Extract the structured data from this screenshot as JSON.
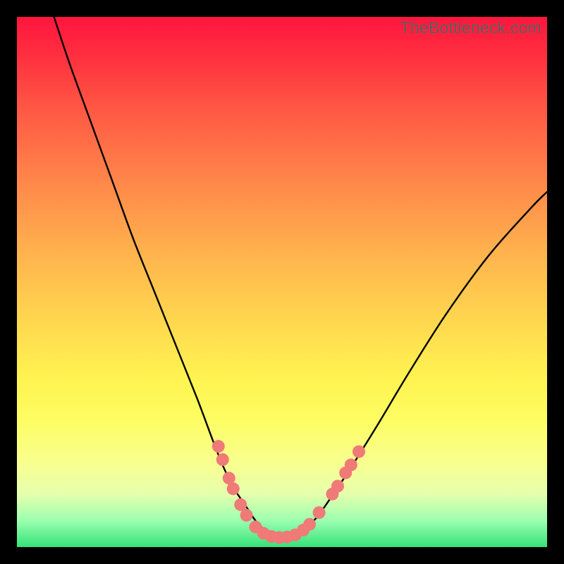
{
  "watermark": "TheBottleneck.com",
  "chart_data": {
    "type": "line",
    "title": "",
    "xlabel": "",
    "ylabel": "",
    "xlim": [
      0,
      100
    ],
    "ylim": [
      0,
      100
    ],
    "series": [
      {
        "name": "bottleneck-curve",
        "x": [
          7,
          10,
          14,
          18,
          22,
          26,
          30,
          34,
          37,
          39,
          41,
          43,
          45,
          47,
          49,
          51,
          53,
          56,
          59,
          63,
          68,
          74,
          81,
          89,
          97,
          100
        ],
        "y": [
          100,
          91,
          80,
          69,
          58,
          48,
          38,
          28,
          20,
          15,
          11,
          8,
          5,
          3,
          2,
          2,
          3,
          5,
          9,
          15,
          23,
          33,
          44,
          55,
          64,
          67
        ]
      }
    ],
    "markers": {
      "name": "highlight-dots",
      "color": "#ef7a78",
      "points": [
        {
          "x": 38.0,
          "y": 19.0
        },
        {
          "x": 38.8,
          "y": 16.5
        },
        {
          "x": 40.0,
          "y": 13.0
        },
        {
          "x": 40.8,
          "y": 11.0
        },
        {
          "x": 42.2,
          "y": 8.0
        },
        {
          "x": 43.3,
          "y": 6.0
        },
        {
          "x": 45.0,
          "y": 3.8
        },
        {
          "x": 46.5,
          "y": 2.6
        },
        {
          "x": 48.0,
          "y": 2.0
        },
        {
          "x": 49.5,
          "y": 1.8
        },
        {
          "x": 51.0,
          "y": 1.9
        },
        {
          "x": 52.5,
          "y": 2.3
        },
        {
          "x": 54.0,
          "y": 3.2
        },
        {
          "x": 55.2,
          "y": 4.3
        },
        {
          "x": 57.0,
          "y": 6.5
        },
        {
          "x": 59.5,
          "y": 10.0
        },
        {
          "x": 60.5,
          "y": 11.5
        },
        {
          "x": 62.0,
          "y": 14.0
        },
        {
          "x": 63.0,
          "y": 15.5
        },
        {
          "x": 64.5,
          "y": 18.0
        }
      ]
    }
  }
}
